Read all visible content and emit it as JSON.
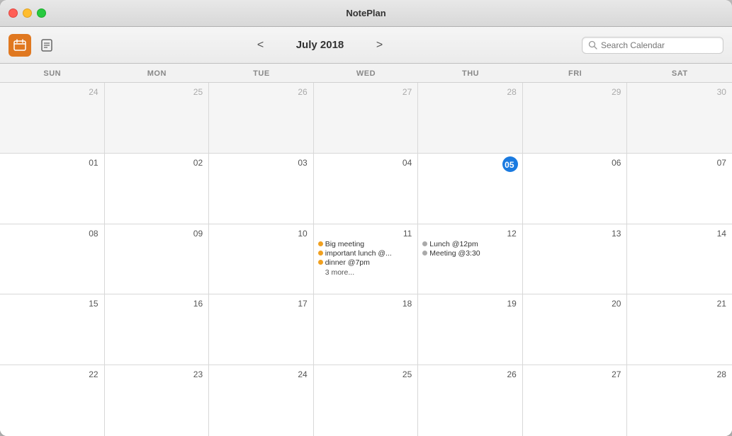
{
  "app": {
    "title": "NotePlan"
  },
  "toolbar": {
    "calendar_icon_label": "calendar",
    "notes_icon_label": "notes",
    "month_title": "July 2018",
    "prev_label": "<",
    "next_label": ">",
    "search_placeholder": "Search Calendar"
  },
  "day_headers": [
    "SUN",
    "MON",
    "TUE",
    "WED",
    "THU",
    "FRI",
    "SAT"
  ],
  "weeks": [
    {
      "days": [
        {
          "number": "24",
          "other_month": true,
          "today": false,
          "events": []
        },
        {
          "number": "25",
          "other_month": true,
          "today": false,
          "events": []
        },
        {
          "number": "26",
          "other_month": true,
          "today": false,
          "events": []
        },
        {
          "number": "27",
          "other_month": true,
          "today": false,
          "events": []
        },
        {
          "number": "28",
          "other_month": true,
          "today": false,
          "events": []
        },
        {
          "number": "29",
          "other_month": true,
          "today": false,
          "events": []
        },
        {
          "number": "30",
          "other_month": true,
          "today": false,
          "events": []
        }
      ]
    },
    {
      "days": [
        {
          "number": "01",
          "other_month": false,
          "today": false,
          "events": []
        },
        {
          "number": "02",
          "other_month": false,
          "today": false,
          "events": []
        },
        {
          "number": "03",
          "other_month": false,
          "today": false,
          "events": []
        },
        {
          "number": "04",
          "other_month": false,
          "today": false,
          "events": []
        },
        {
          "number": "05",
          "other_month": false,
          "today": true,
          "events": []
        },
        {
          "number": "06",
          "other_month": false,
          "today": false,
          "events": []
        },
        {
          "number": "07",
          "other_month": false,
          "today": false,
          "events": []
        }
      ]
    },
    {
      "days": [
        {
          "number": "08",
          "other_month": false,
          "today": false,
          "events": []
        },
        {
          "number": "09",
          "other_month": false,
          "today": false,
          "events": []
        },
        {
          "number": "10",
          "other_month": false,
          "today": false,
          "events": []
        },
        {
          "number": "11",
          "other_month": false,
          "today": false,
          "events": [
            {
              "text": "Big meeting",
              "color": "#f0a020"
            },
            {
              "text": "important lunch @...",
              "color": "#f0a020"
            },
            {
              "text": "dinner @7pm",
              "color": "#f0a020"
            },
            {
              "text": "3 more...",
              "color": null
            }
          ]
        },
        {
          "number": "12",
          "other_month": false,
          "today": false,
          "events": [
            {
              "text": "Lunch @12pm",
              "color": "#aaa"
            },
            {
              "text": "Meeting @3:30",
              "color": "#aaa"
            }
          ]
        },
        {
          "number": "13",
          "other_month": false,
          "today": false,
          "events": []
        },
        {
          "number": "14",
          "other_month": false,
          "today": false,
          "events": []
        }
      ]
    },
    {
      "days": [
        {
          "number": "15",
          "other_month": false,
          "today": false,
          "events": []
        },
        {
          "number": "16",
          "other_month": false,
          "today": false,
          "events": []
        },
        {
          "number": "17",
          "other_month": false,
          "today": false,
          "events": []
        },
        {
          "number": "18",
          "other_month": false,
          "today": false,
          "events": []
        },
        {
          "number": "19",
          "other_month": false,
          "today": false,
          "events": []
        },
        {
          "number": "20",
          "other_month": false,
          "today": false,
          "events": []
        },
        {
          "number": "21",
          "other_month": false,
          "today": false,
          "events": []
        }
      ]
    },
    {
      "days": [
        {
          "number": "22",
          "other_month": false,
          "today": false,
          "events": []
        },
        {
          "number": "23",
          "other_month": false,
          "today": false,
          "events": []
        },
        {
          "number": "24",
          "other_month": false,
          "today": false,
          "events": []
        },
        {
          "number": "25",
          "other_month": false,
          "today": false,
          "events": []
        },
        {
          "number": "26",
          "other_month": false,
          "today": false,
          "events": []
        },
        {
          "number": "27",
          "other_month": false,
          "today": false,
          "events": []
        },
        {
          "number": "28",
          "other_month": false,
          "today": false,
          "events": []
        }
      ]
    }
  ],
  "colors": {
    "orange_active": "#e07820",
    "today_blue": "#1a7ae0",
    "event_yellow": "#f0a020",
    "event_gray": "#aaa"
  }
}
